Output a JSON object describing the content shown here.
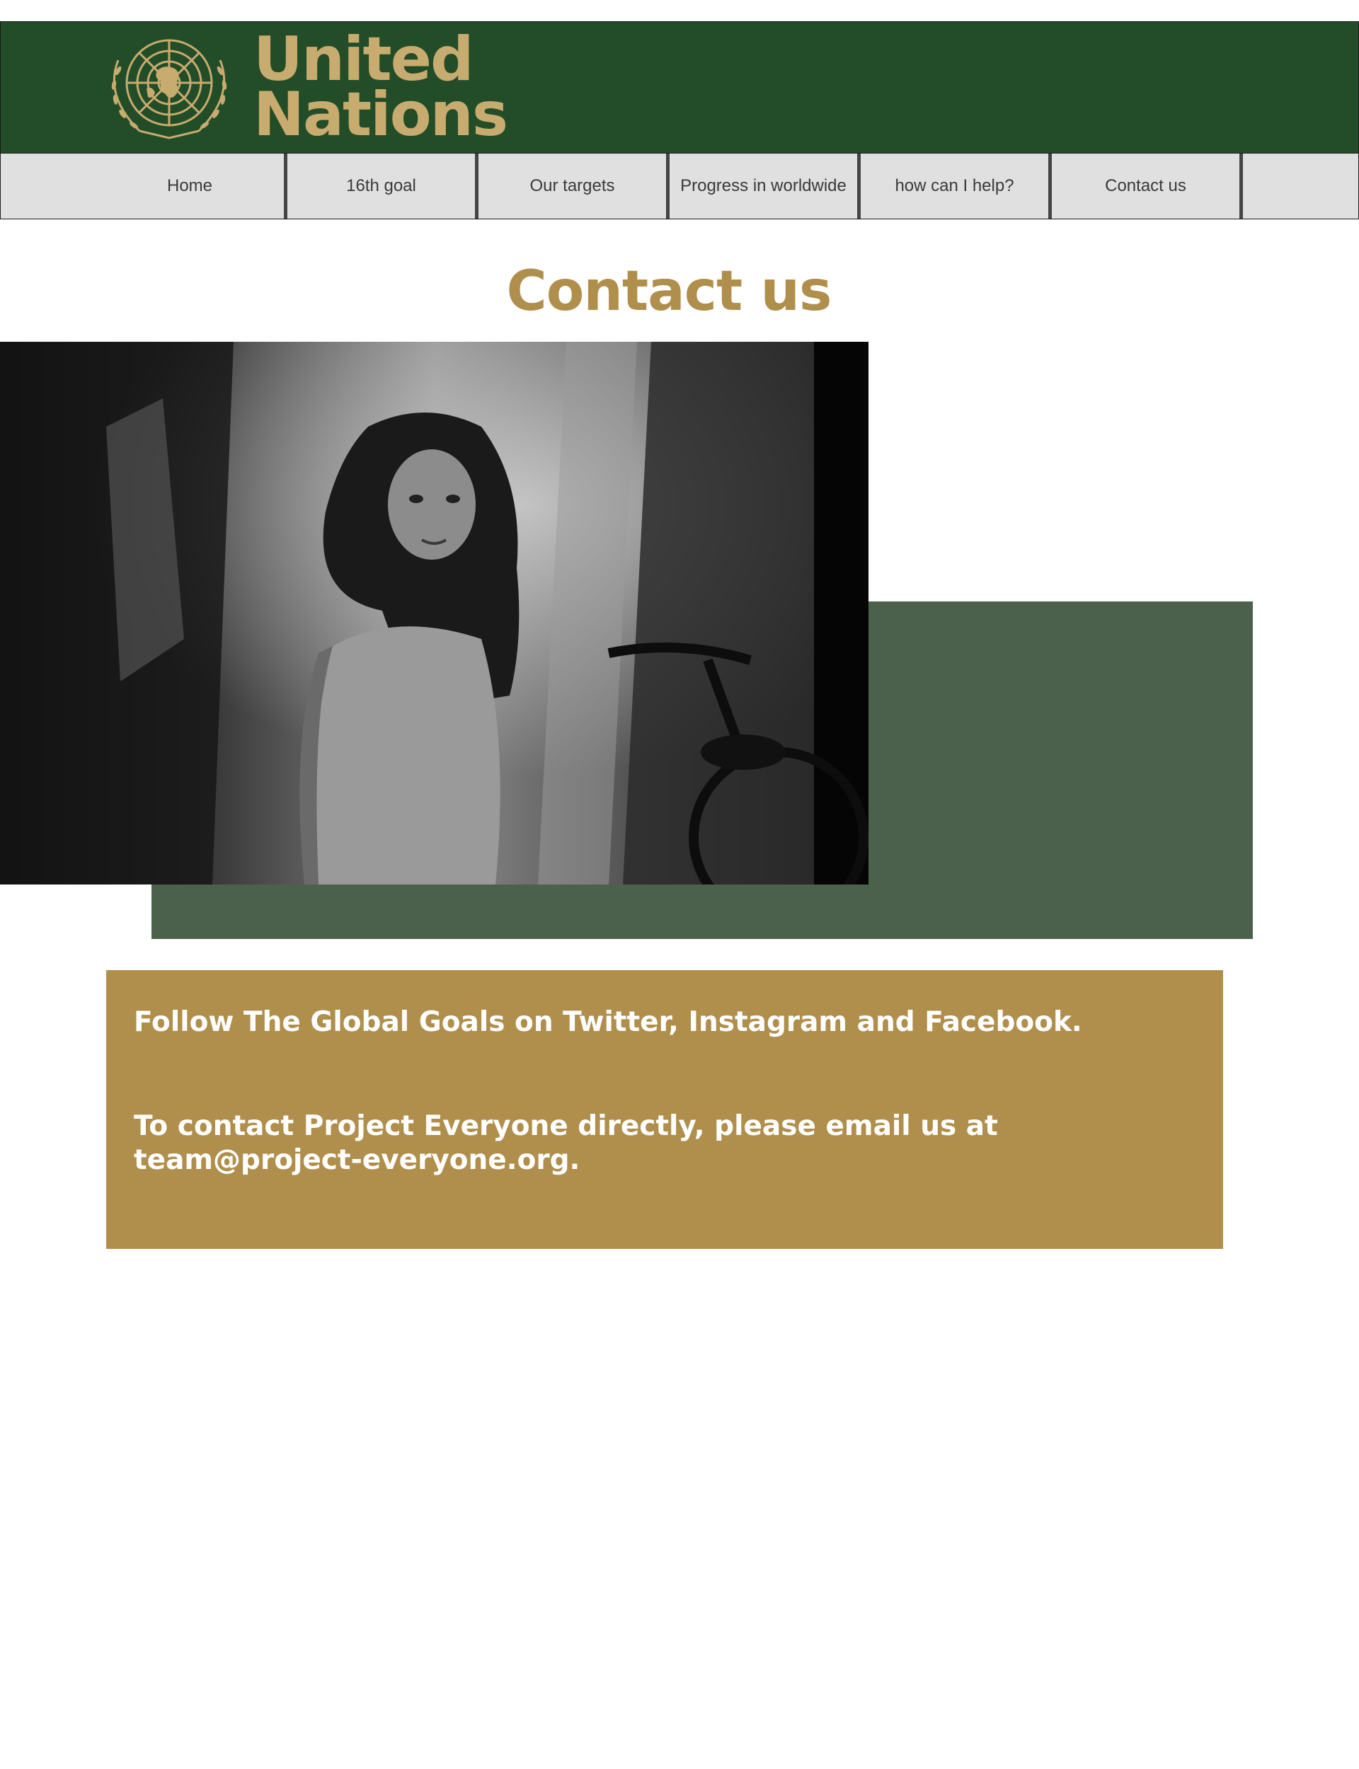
{
  "header": {
    "brand_line1": "United",
    "brand_line2": "Nations",
    "emblem_icon": "un-emblem-icon",
    "background_color": "#234d29",
    "brand_color": "#c8ab6e"
  },
  "nav": {
    "items": [
      {
        "label": "Home"
      },
      {
        "label": "16th goal"
      },
      {
        "label": "Our targets"
      },
      {
        "label": "Progress in worldwide"
      },
      {
        "label": "how can I help?"
      },
      {
        "label": "Contact us"
      },
      {
        "label": ""
      }
    ]
  },
  "main": {
    "title": "Contact us",
    "title_color": "#b08f4c",
    "accent_green": "#4b614c"
  },
  "info": {
    "follow_text": "Follow The Global Goals on Twitter, Instagram and Facebook.",
    "contact_line1": "To contact Project Everyone directly, please email us at",
    "contact_line2": "team@project-everyone.org.",
    "background_color": "#b08f4c"
  }
}
